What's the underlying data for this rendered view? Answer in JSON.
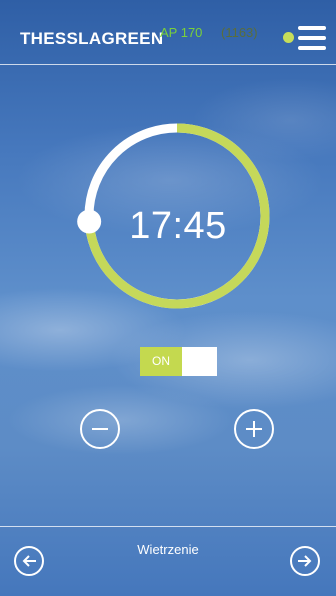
{
  "header": {
    "brand": "THESSLAGREEN",
    "model": "AP 170",
    "code": "(1163)",
    "status_color": "#c7de5a",
    "menu_icon": "hamburger-menu-icon"
  },
  "timer": {
    "time": "17:45",
    "progress_fraction": 0.74,
    "progress_color": "#c5d85a",
    "track_color": "#ffffff"
  },
  "toggle": {
    "label": "ON",
    "state": true,
    "color": "#c4d94f"
  },
  "controls": {
    "decrease_icon": "minus-icon",
    "increase_icon": "plus-icon"
  },
  "footer": {
    "mode_label": "Wietrzenie",
    "prev_icon": "arrow-left-icon",
    "next_icon": "arrow-right-icon"
  }
}
